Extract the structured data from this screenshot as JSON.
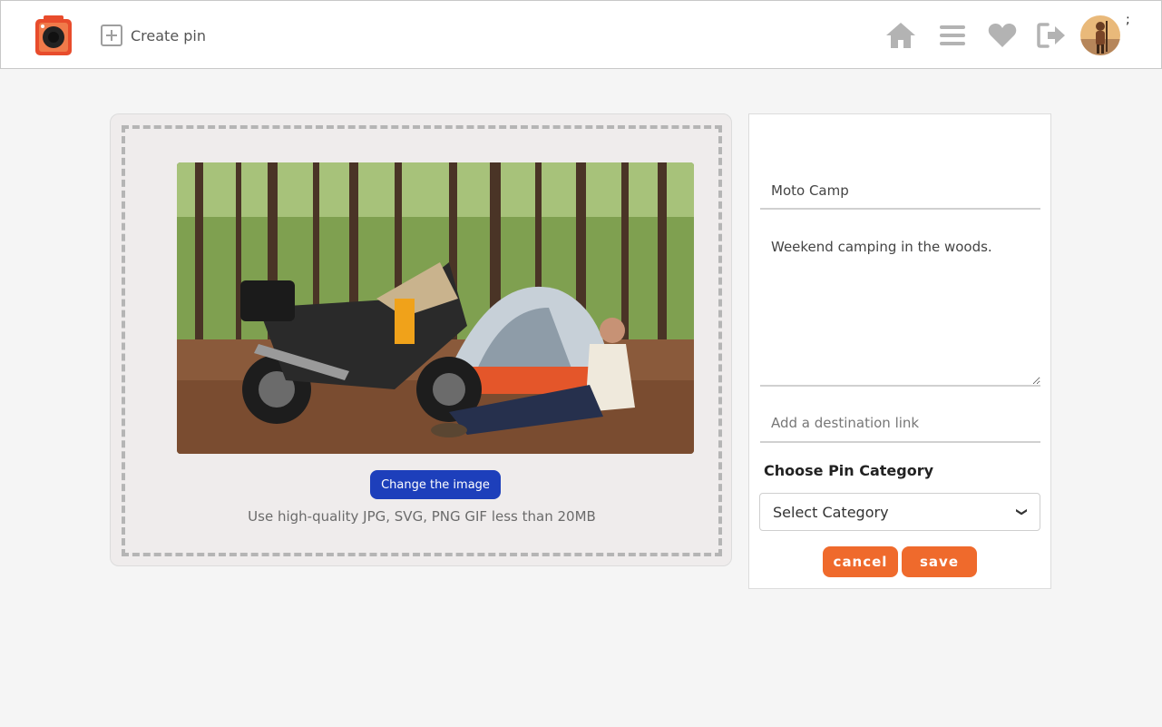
{
  "header": {
    "create_pin_label": "Create pin",
    "avatar_menu": ";"
  },
  "icons": {
    "logo": "camera-app-logo",
    "create": "plus-square-icon",
    "home": "home-icon",
    "menu": "menu-icon",
    "favorites": "heart-icon",
    "logout": "logout-icon"
  },
  "upload": {
    "change_button": "Change the image",
    "hint": "Use high-quality JPG, SVG, PNG GIF less than 20MB"
  },
  "form": {
    "title_value": "Moto Camp",
    "description_value": "Weekend camping in the woods.",
    "destination_placeholder": "Add a destination link",
    "category_label": "Choose Pin Category",
    "category_selected": "Select Category",
    "cancel_label": "cancel",
    "save_label": "save"
  },
  "colors": {
    "accent_orange": "#ef6a2c",
    "primary_blue": "#1d3fbb",
    "icon_gray": "#b3b3b3"
  }
}
